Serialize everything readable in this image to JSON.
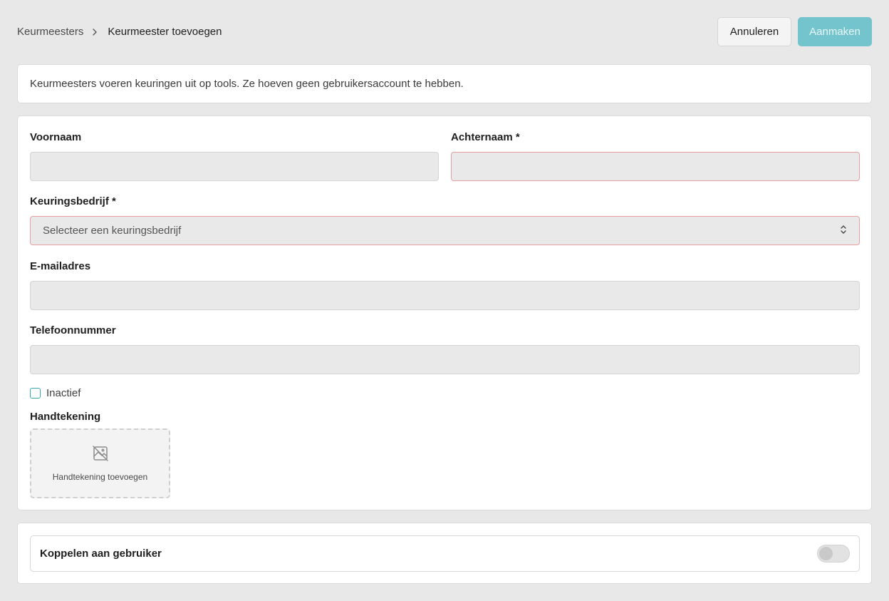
{
  "breadcrumb": {
    "parent": "Keurmeesters",
    "current": "Keurmeester toevoegen"
  },
  "actions": {
    "cancel_label": "Annuleren",
    "create_label": "Aanmaken"
  },
  "info": {
    "text": "Keurmeesters voeren keuringen uit op tools. Ze hoeven geen gebruikersaccount te hebben."
  },
  "form": {
    "first_name": {
      "label": "Voornaam",
      "value": ""
    },
    "last_name": {
      "label": "Achternaam *",
      "value": ""
    },
    "company": {
      "label": "Keuringsbedrijf *",
      "placeholder": "Selecteer een keuringsbedrijf"
    },
    "email": {
      "label": "E-mailadres",
      "value": ""
    },
    "phone": {
      "label": "Telefoonnummer",
      "value": ""
    },
    "inactive": {
      "label": "Inactief",
      "checked": false
    },
    "signature": {
      "label": "Handtekening",
      "add_label": "Handtekening toevoegen"
    }
  },
  "link_user": {
    "label": "Koppelen aan gebruiker",
    "enabled": false
  },
  "colors": {
    "accent": "#74c4cd",
    "error_border": "#e7a0a0",
    "checkbox_border": "#3aa6b2"
  },
  "icons": {
    "breadcrumb_separator": "chevron-right-icon",
    "select_caret": "chevron-up-down-icon",
    "signature_placeholder": "image-off-icon"
  }
}
